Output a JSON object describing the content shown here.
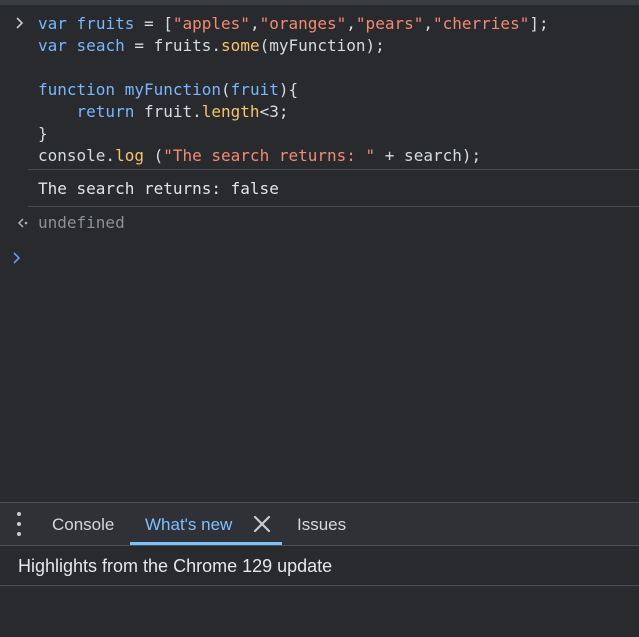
{
  "console": {
    "code": {
      "line1": {
        "kw": "var",
        "name": "fruits",
        "op": " = [",
        "s1": "\"apples\"",
        "c1": ",",
        "s2": "\"oranges\"",
        "c2": ",",
        "s3": "\"pears\"",
        "c3": ",",
        "s4": "\"cherries\"",
        "end": "];"
      },
      "line2": {
        "kw": "var",
        "name": "seach",
        "op": " = fruits.",
        "method": "some",
        "end": "(myFunction);"
      },
      "line4": {
        "kw": "function",
        "name": "myFunction",
        "paren_open": "(",
        "param": "fruit",
        "end": "){"
      },
      "line5": {
        "kw": "return",
        "mid": " fruit.",
        "prop": "length",
        "end": "<3;"
      },
      "line6": "}",
      "line7": {
        "start": "console.",
        "method": "log",
        "mid": " (",
        "str": "\"The search returns: \"",
        "end": " + search);"
      }
    },
    "output": "The search returns: false",
    "return_value": "undefined"
  },
  "drawer": {
    "tabs": {
      "console": "Console",
      "whats_new": "What's new",
      "issues": "Issues"
    },
    "highlights": "Highlights from the Chrome 129 update"
  },
  "colors": {
    "keyword": "#76b7ff",
    "function_call": "#f7c46c",
    "string": "#f48a73",
    "active_tab": "#7cc0ff",
    "background": "#282a2d"
  },
  "icons": {
    "input_chevron": "chevron-right-icon",
    "return_arrow": "return-value-arrow-icon",
    "prompt": "console-prompt-icon",
    "menu": "kebab-menu-icon",
    "close": "close-icon"
  }
}
